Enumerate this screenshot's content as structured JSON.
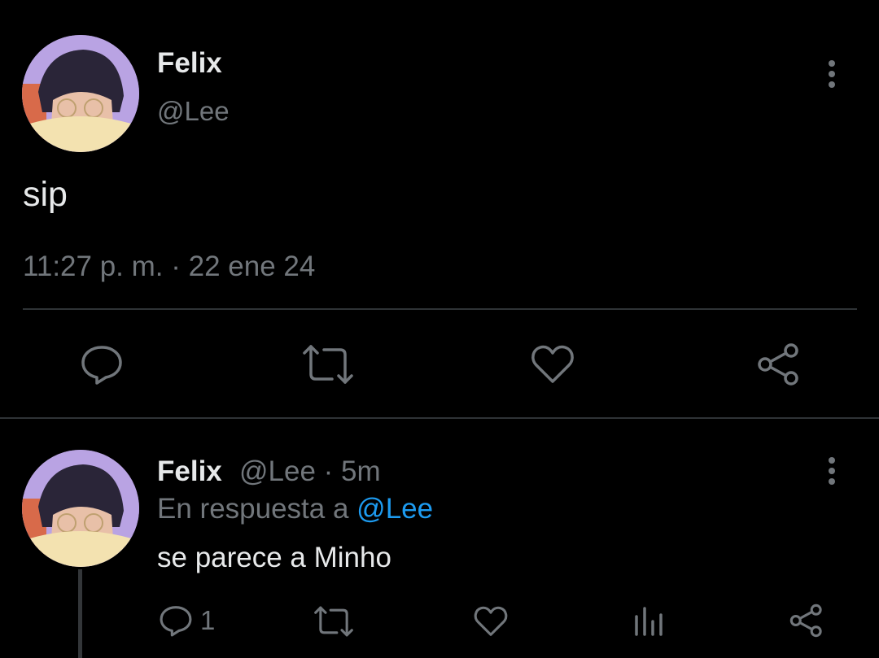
{
  "main_tweet": {
    "author_name": "Felix",
    "handle": "@Lee",
    "text": "sip",
    "timestamp": "11:27 p. m. · 22 ene 24",
    "more_icon": "more-vertical-icon",
    "actions": [
      "reply-icon",
      "retweet-icon",
      "like-icon",
      "share-icon"
    ]
  },
  "reply_tweet": {
    "author_name": "Felix",
    "handle_time": "@Lee · 5m",
    "replying_prefix": "En respuesta a",
    "replying_handle": "@Lee",
    "text": "se parece a Minho",
    "reply_count": "1",
    "more_icon": "more-vertical-icon",
    "actions": [
      "reply-icon",
      "retweet-icon",
      "like-icon",
      "views-icon",
      "share-icon"
    ]
  },
  "colors": {
    "background": "#000000",
    "text": "#e7e9ea",
    "muted": "#71767b",
    "link": "#1d9bf0",
    "divider": "#2f3336"
  }
}
